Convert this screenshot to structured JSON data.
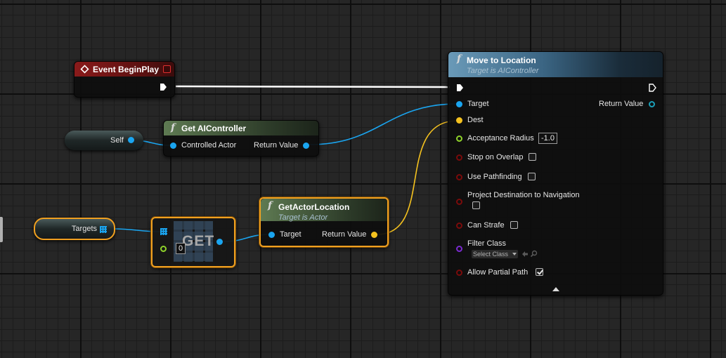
{
  "colors": {
    "exec": "#ffffff",
    "object": "#1aa5f0",
    "vector": "#f5c21f",
    "float": "#8fd32a",
    "bool": "#7a0b0b",
    "class": "#7a2ad0",
    "selected": "#f0a020"
  },
  "event_begin_play": {
    "title": "Event BeginPlay",
    "icon": "diamond-event-icon"
  },
  "move_to_location": {
    "title": "Move to Location",
    "subtitle": "Target is AIController",
    "pins": {
      "target": "Target",
      "return_value": "Return Value",
      "dest": "Dest",
      "acceptance_radius": "Acceptance Radius",
      "acceptance_radius_value": "-1.0",
      "stop_on_overlap": "Stop on Overlap",
      "use_pathfinding": "Use Pathfinding",
      "project_destination": "Project Destination to Navigation",
      "can_strafe": "Can Strafe",
      "filter_class": "Filter Class",
      "filter_class_select": "Select Class",
      "allow_partial_path": "Allow Partial Path"
    },
    "checkboxes": {
      "stop_on_overlap": false,
      "use_pathfinding": false,
      "project_destination": false,
      "can_strafe": false,
      "allow_partial_path": true
    }
  },
  "get_ai_controller": {
    "title": "Get AIController",
    "input": "Controlled Actor",
    "output": "Return Value"
  },
  "self_node": {
    "label": "Self"
  },
  "targets_node": {
    "label": "Targets"
  },
  "get_node": {
    "label": "GET",
    "index": "0"
  },
  "get_actor_location": {
    "title": "GetActorLocation",
    "subtitle": "Target is Actor",
    "input": "Target",
    "output": "Return Value"
  }
}
